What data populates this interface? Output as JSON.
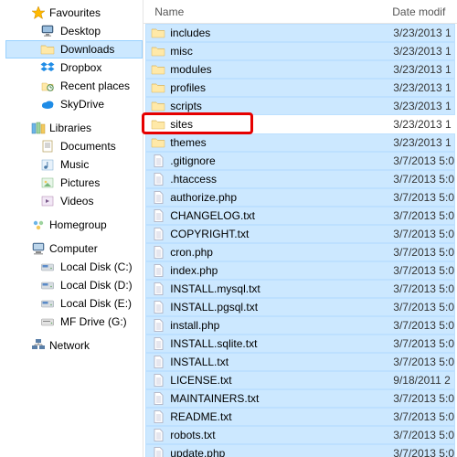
{
  "columns": {
    "name": "Name",
    "date": "Date modif"
  },
  "sidebar": {
    "favourites": {
      "label": "Favourites",
      "items": [
        {
          "label": "Desktop",
          "icon": "desktop"
        },
        {
          "label": "Downloads",
          "icon": "folder",
          "selected": true
        },
        {
          "label": "Dropbox",
          "icon": "dropbox"
        },
        {
          "label": "Recent places",
          "icon": "recent"
        },
        {
          "label": "SkyDrive",
          "icon": "skydrive"
        }
      ]
    },
    "libraries": {
      "label": "Libraries",
      "items": [
        {
          "label": "Documents",
          "icon": "doclib"
        },
        {
          "label": "Music",
          "icon": "musiclib"
        },
        {
          "label": "Pictures",
          "icon": "piclib"
        },
        {
          "label": "Videos",
          "icon": "vidlib"
        }
      ]
    },
    "homegroup": {
      "label": "Homegroup"
    },
    "computer": {
      "label": "Computer",
      "items": [
        {
          "label": "Local Disk (C:)",
          "icon": "disk"
        },
        {
          "label": "Local Disk (D:)",
          "icon": "disk"
        },
        {
          "label": "Local Disk (E:)",
          "icon": "disk"
        },
        {
          "label": "MF Drive (G:)",
          "icon": "drive"
        }
      ]
    },
    "network": {
      "label": "Network"
    }
  },
  "files": [
    {
      "name": "includes",
      "date": "3/23/2013 1",
      "type": "folder",
      "selected": true
    },
    {
      "name": "misc",
      "date": "3/23/2013 1",
      "type": "folder",
      "selected": true
    },
    {
      "name": "modules",
      "date": "3/23/2013 1",
      "type": "folder",
      "selected": true
    },
    {
      "name": "profiles",
      "date": "3/23/2013 1",
      "type": "folder",
      "selected": true
    },
    {
      "name": "scripts",
      "date": "3/23/2013 1",
      "type": "folder",
      "selected": true
    },
    {
      "name": "sites",
      "date": "3/23/2013 1",
      "type": "folder",
      "selected": false,
      "highlighted": true
    },
    {
      "name": "themes",
      "date": "3/23/2013 1",
      "type": "folder",
      "selected": true
    },
    {
      "name": ".gitignore",
      "date": "3/7/2013 5:0",
      "type": "file",
      "selected": true
    },
    {
      "name": ".htaccess",
      "date": "3/7/2013 5:0",
      "type": "file",
      "selected": true
    },
    {
      "name": "authorize.php",
      "date": "3/7/2013 5:0",
      "type": "file",
      "selected": true
    },
    {
      "name": "CHANGELOG.txt",
      "date": "3/7/2013 5:0",
      "type": "file",
      "selected": true
    },
    {
      "name": "COPYRIGHT.txt",
      "date": "3/7/2013 5:0",
      "type": "file",
      "selected": true
    },
    {
      "name": "cron.php",
      "date": "3/7/2013 5:0",
      "type": "file",
      "selected": true
    },
    {
      "name": "index.php",
      "date": "3/7/2013 5:0",
      "type": "file",
      "selected": true
    },
    {
      "name": "INSTALL.mysql.txt",
      "date": "3/7/2013 5:0",
      "type": "file",
      "selected": true
    },
    {
      "name": "INSTALL.pgsql.txt",
      "date": "3/7/2013 5:0",
      "type": "file",
      "selected": true
    },
    {
      "name": "install.php",
      "date": "3/7/2013 5:0",
      "type": "file",
      "selected": true
    },
    {
      "name": "INSTALL.sqlite.txt",
      "date": "3/7/2013 5:0",
      "type": "file",
      "selected": true
    },
    {
      "name": "INSTALL.txt",
      "date": "3/7/2013 5:0",
      "type": "file",
      "selected": true
    },
    {
      "name": "LICENSE.txt",
      "date": "9/18/2011 2",
      "type": "file",
      "selected": true
    },
    {
      "name": "MAINTAINERS.txt",
      "date": "3/7/2013 5:0",
      "type": "file",
      "selected": true
    },
    {
      "name": "README.txt",
      "date": "3/7/2013 5:0",
      "type": "file",
      "selected": true
    },
    {
      "name": "robots.txt",
      "date": "3/7/2013 5:0",
      "type": "file",
      "selected": true
    },
    {
      "name": "update.php",
      "date": "3/7/2013 5:0",
      "type": "file",
      "selected": true
    }
  ]
}
